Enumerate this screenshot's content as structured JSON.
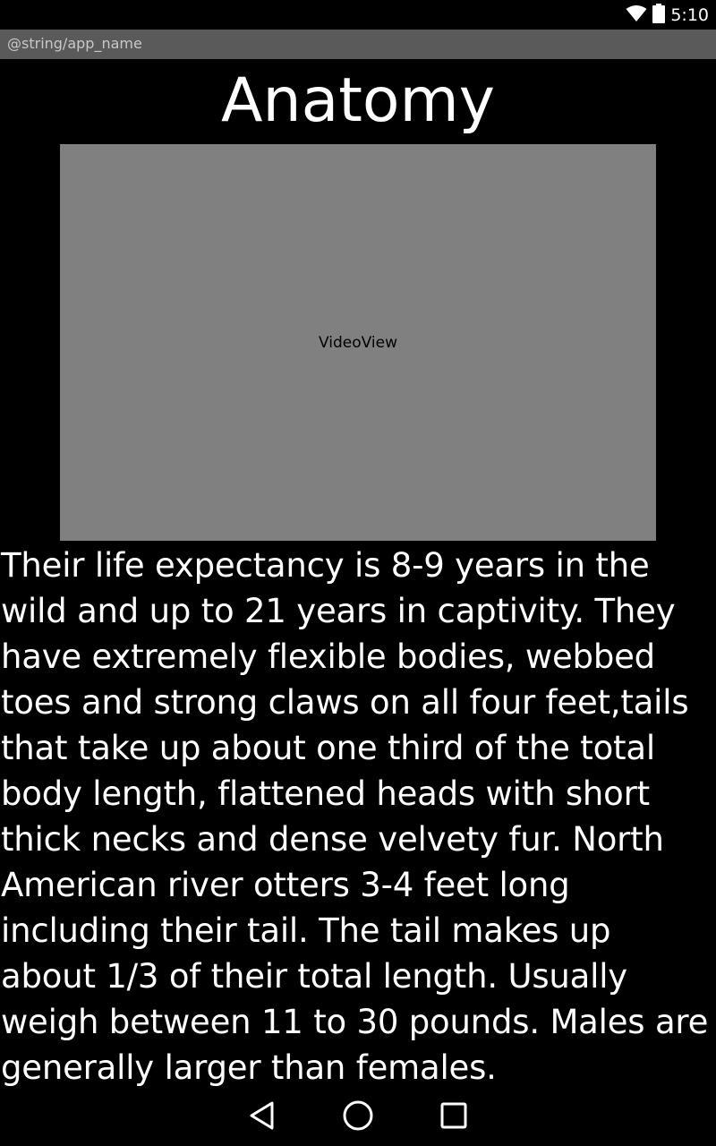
{
  "status_bar": {
    "time": "5:10",
    "icons": [
      "wifi-icon",
      "battery-icon"
    ]
  },
  "action_bar": {
    "title": "@string/app_name"
  },
  "main": {
    "title": "Anatomy",
    "video_view_label": "VideoView",
    "body": "Their life expectancy is 8-9 years in the wild and up to 21 years in captivity. They have extremely flexible bodies, webbed toes and strong claws on all four feet,tails that take up about one third of the total body length, flattened heads with short thick necks and dense velvety fur. North American river otters 3-4 feet long including their tail. The tail makes up about 1/3 of their total length. Usually weigh between 11 to 30 pounds. Males are generally larger than females."
  },
  "nav_bar": {
    "buttons": [
      "back-icon",
      "home-icon",
      "recents-icon"
    ]
  },
  "colors": {
    "background": "#000000",
    "action_bar": "#5a5a5a",
    "video_placeholder": "#808080",
    "text": "#ffffff"
  }
}
